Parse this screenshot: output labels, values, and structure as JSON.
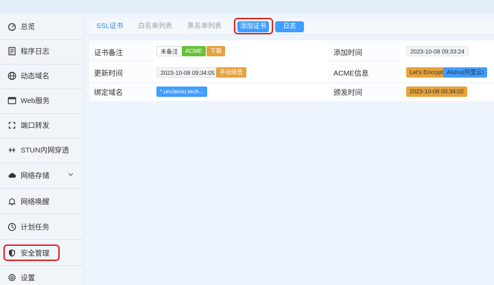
{
  "sidebar": {
    "items": [
      {
        "label": "总览",
        "icon": "dashboard-icon"
      },
      {
        "label": "程序日志",
        "icon": "log-icon"
      },
      {
        "label": "动态域名",
        "icon": "globe-icon"
      },
      {
        "label": "Web服务",
        "icon": "browser-icon"
      },
      {
        "label": "端口转发",
        "icon": "port-forward-icon"
      },
      {
        "label": "STUN内网穿透",
        "icon": "stun-icon"
      },
      {
        "label": "网络存储",
        "icon": "cloud-icon"
      },
      {
        "label": "网络唤醒",
        "icon": "bell-icon"
      },
      {
        "label": "计划任务",
        "icon": "clock-icon"
      },
      {
        "label": "安全管理",
        "icon": "shield-icon"
      },
      {
        "label": "设置",
        "icon": "gear-icon"
      }
    ]
  },
  "tabs": {
    "ssl": "SSL证书",
    "whitelist": "白名单列表",
    "blacklist": "黑名单列表",
    "add_cert": "添加证书",
    "log": "日志"
  },
  "cert": {
    "remark_label": "证书备注",
    "remark_value": "未备注",
    "acme_tag": "ACME",
    "download": "下载",
    "added_label": "添加时间",
    "added_value": "2023-10-08 09:33:24",
    "updated_label": "更新时间",
    "updated_value": "2023-10-08 09:34:05",
    "manual_renew": "手动续签",
    "acme_info_label": "ACME信息",
    "acme_provider": "Let's Encrypt",
    "acme_dns": "Alidns(阿里云)",
    "domain_label": "绑定域名",
    "domain_value": "*.uncleroo.tech...",
    "issued_label": "颁发时间",
    "issued_value": "2023-10-08 00:34:02"
  },
  "colors": {
    "accent": "#409eff",
    "highlight": "#e02020"
  }
}
